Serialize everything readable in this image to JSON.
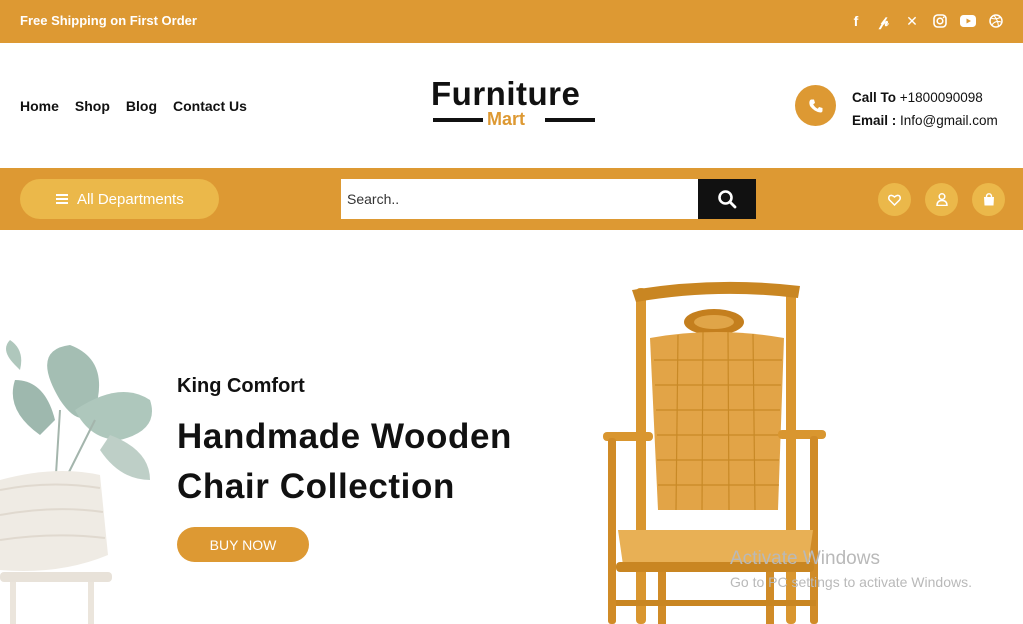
{
  "topbar": {
    "shipping_text": "Free Shipping on First Order",
    "social_icons": [
      "facebook-icon",
      "pinterest-icon",
      "x-icon",
      "instagram-icon",
      "youtube-icon",
      "dribbble-icon"
    ],
    "background": "#dd9933"
  },
  "nav": {
    "items": [
      "Home",
      "Shop",
      "Blog",
      "Contact Us"
    ]
  },
  "logo": {
    "primary": "Furniture",
    "secondary": "Mart"
  },
  "contact": {
    "call_label": "Call To",
    "phone": "+1800090098",
    "email_label": "Email :",
    "email": "Info@gmail.com"
  },
  "catbar": {
    "departments_label": "All Departments",
    "search_placeholder": "Search..",
    "icons": [
      "heart-icon",
      "user-icon",
      "bag-icon"
    ]
  },
  "hero": {
    "subtitle": "King Comfort",
    "title_line1": "Handmade Wooden",
    "title_line2": "Chair Collection",
    "cta": "BUY NOW"
  },
  "watermark": {
    "line1": "Activate Windows",
    "line2": "Go to PC settings to activate Windows."
  },
  "colors": {
    "accent": "#dd9933",
    "accent_light": "#ebb84a",
    "dark": "#111111"
  }
}
